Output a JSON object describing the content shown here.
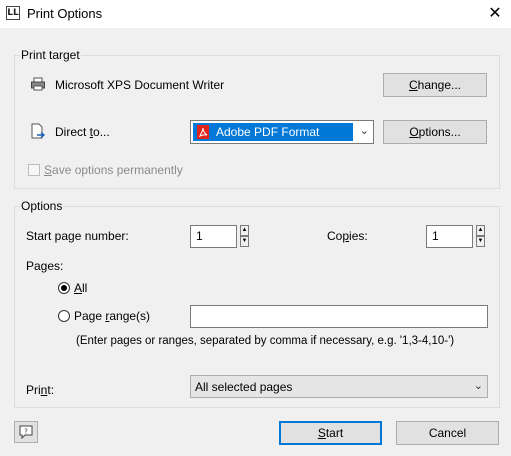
{
  "window": {
    "title": "Print Options",
    "app_icon": "LL"
  },
  "print_target": {
    "group_title": "Print target",
    "printer_name": "Microsoft XPS Document Writer",
    "change_label": "Change...",
    "direct_to_label": "Direct to...",
    "format_value": "Adobe PDF Format",
    "options_label": "Options...",
    "save_options_label": "Save options permanently"
  },
  "options": {
    "group_title": "Options",
    "start_page_label": "Start page number:",
    "start_page_value": "1",
    "copies_label": "Copies:",
    "copies_value": "1",
    "pages_label": "Pages:",
    "all_label": "All",
    "page_range_label": "Page range(s)",
    "page_range_value": "",
    "hint": "(Enter pages or ranges, separated by comma if necessary, e.g. '1,3-4,10-')",
    "print_label": "Print:",
    "print_value": "All selected pages"
  },
  "footer": {
    "start_label": "Start",
    "cancel_label": "Cancel"
  },
  "colors": {
    "accent": "#0078d7",
    "pdf_red": "#e2231a",
    "selected_bg": "#0078d7"
  }
}
